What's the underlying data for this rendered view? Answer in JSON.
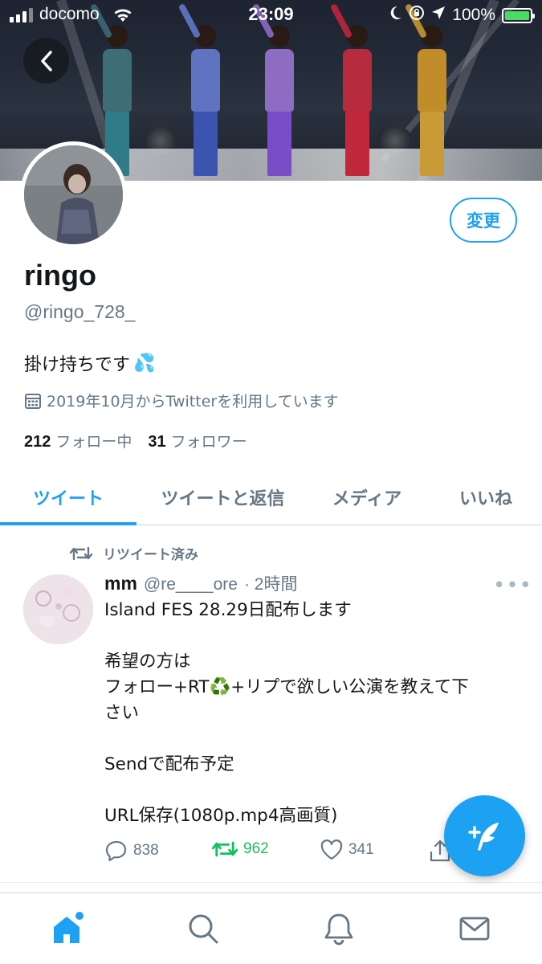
{
  "status_bar": {
    "carrier": "docomo",
    "time": "23:09",
    "battery": "100%"
  },
  "profile": {
    "edit_label": "変更",
    "display_name": "ringo",
    "handle": "@ringo_728_",
    "bio": "掛け持ちです",
    "bio_emoji": "💦",
    "joined": "2019年10月からTwitterを利用しています",
    "following_count": "212",
    "following_label": "フォロー中",
    "followers_count": "31",
    "followers_label": "フォロワー"
  },
  "tabs": [
    {
      "label": "ツイート",
      "active": true
    },
    {
      "label": "ツイートと返信",
      "active": false
    },
    {
      "label": "メディア",
      "active": false
    },
    {
      "label": "いいね",
      "active": false
    }
  ],
  "tweet": {
    "retweet_label": "リツイート済み",
    "author_name": "mm",
    "author_handle": "@re____ore",
    "time": "· 2時間",
    "lines": [
      "Island FES 28.29日配布します",
      "",
      "希望の方は",
      "フォロー+RT♻️+リプで欲しい公演を教えて下",
      "さい",
      "",
      "Sendで配布予定",
      "",
      "URL保存(1080p.mp4高画質)"
    ],
    "replies": "838",
    "retweets": "962",
    "likes": "341"
  },
  "colors": {
    "accent": "#1da1f2",
    "retweet_green": "#17bf63",
    "secondary_text": "#657786"
  },
  "icons": {
    "back": "chevron-left-icon",
    "calendar": "calendar-icon",
    "retweet": "retweet-icon",
    "reply": "reply-icon",
    "like": "heart-icon",
    "share": "share-icon",
    "compose": "compose-tweet-icon",
    "nav": [
      "home-icon",
      "search-icon",
      "notifications-icon",
      "messages-icon"
    ]
  }
}
